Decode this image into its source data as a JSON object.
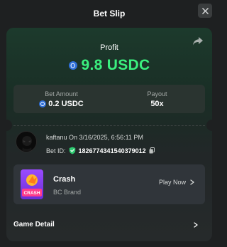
{
  "header": {
    "title": "Bet Slip"
  },
  "profit": {
    "label": "Profit",
    "value": "9.8 USDC"
  },
  "stats": {
    "bet_amount_label": "Bet Amount",
    "bet_amount_value": "0.2 USDC",
    "payout_label": "Payout",
    "payout_value": "50x"
  },
  "bet_info": {
    "user_line": "kaftanu On 3/16/2025, 6:56:11 PM",
    "bet_id_label": "Bet ID:",
    "bet_id_value": "1826774341540379012"
  },
  "game": {
    "name": "Crash",
    "brand": "BC Brand",
    "thumb_text": "CRASH",
    "play_label": "Play Now"
  },
  "footer": {
    "game_detail_label": "Game Detail"
  },
  "colors": {
    "profit_green": "#3bf07f",
    "coin_blue": "#2f6fd8",
    "verified_green": "#2ecc71",
    "thumb_purple": "#8a3ff0"
  },
  "icons": {
    "close": "close-icon",
    "share": "share-icon",
    "coin": "usdc-coin-icon",
    "verified": "verified-shield-icon",
    "copy": "copy-icon",
    "chevron": "chevron-right-icon"
  }
}
